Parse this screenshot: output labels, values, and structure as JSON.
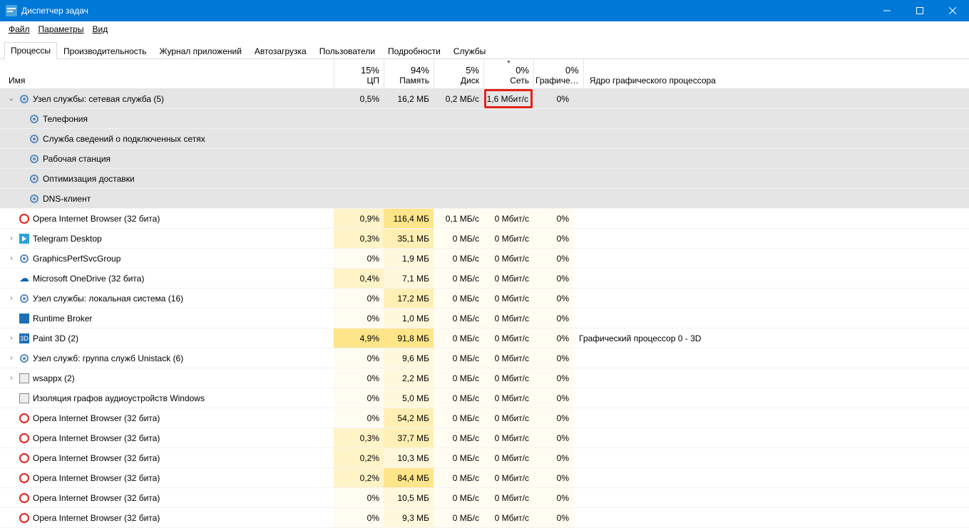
{
  "window": {
    "title": "Диспетчер задач"
  },
  "menu": {
    "file": "Файл",
    "options": "Параметры",
    "view": "Вид"
  },
  "tabs": {
    "processes": "Процессы",
    "performance": "Производительность",
    "apphistory": "Журнал приложений",
    "startup": "Автозагрузка",
    "users": "Пользователи",
    "details": "Подробности",
    "services": "Службы"
  },
  "columns": {
    "name": "Имя",
    "cpu_pct": "15%",
    "cpu_label": "ЦП",
    "mem_pct": "94%",
    "mem_label": "Память",
    "disk_pct": "5%",
    "disk_label": "Диск",
    "net_pct": "0%",
    "net_label": "Сеть",
    "gpu_pct": "0%",
    "gpu_label": "Графиче…",
    "gpue_label": "Ядро графического процессора"
  },
  "selected": {
    "name": "Узел службы: сетевая служба (5)",
    "cpu": "0,5%",
    "mem": "16,2 МБ",
    "disk": "0,2 МБ/с",
    "net": "1,6 Мбит/с",
    "gpu": "0%",
    "children": [
      "Телефония",
      "Служба сведений о подключенных сетях",
      "Рабочая станция",
      "Оптимизация доставки",
      "DNS-клиент"
    ]
  },
  "rows": [
    {
      "icon": "opera",
      "name": "Opera Internet Browser (32 бита)",
      "cpu": "0,9%",
      "mem": "116,4 МБ",
      "mem_h": 3,
      "cpu_h": 1,
      "disk": "0,1 МБ/с",
      "net": "0 Мбит/с",
      "gpu": "0%",
      "gpue": ""
    },
    {
      "icon": "telegram",
      "exp": true,
      "name": "Telegram Desktop",
      "cpu": "0,3%",
      "mem": "35,1 МБ",
      "mem_h": 2,
      "cpu_h": 1,
      "disk": "0 МБ/с",
      "net": "0 Мбит/с",
      "gpu": "0%",
      "gpue": ""
    },
    {
      "icon": "gear",
      "exp": true,
      "name": "GraphicsPerfSvcGroup",
      "cpu": "0%",
      "mem": "1,9 МБ",
      "mem_h": 1,
      "cpu_h": 0,
      "disk": "0 МБ/с",
      "net": "0 Мбит/с",
      "gpu": "0%",
      "gpue": ""
    },
    {
      "icon": "onedrive",
      "name": "Microsoft OneDrive (32 бита)",
      "cpu": "0,4%",
      "mem": "7,1 МБ",
      "mem_h": 1,
      "cpu_h": 1,
      "disk": "0 МБ/с",
      "net": "0 Мбит/с",
      "gpu": "0%",
      "gpue": ""
    },
    {
      "icon": "gear",
      "exp": true,
      "name": "Узел службы: локальная система (16)",
      "cpu": "0%",
      "mem": "17,2 МБ",
      "mem_h": 2,
      "cpu_h": 0,
      "disk": "0 МБ/с",
      "net": "0 Мбит/с",
      "gpu": "0%",
      "gpue": ""
    },
    {
      "icon": "runtime",
      "name": "Runtime Broker",
      "cpu": "0%",
      "mem": "1,0 МБ",
      "mem_h": 1,
      "cpu_h": 0,
      "disk": "0 МБ/с",
      "net": "0 Мбит/с",
      "gpu": "0%",
      "gpue": ""
    },
    {
      "icon": "paint3d",
      "exp": true,
      "name": "Paint 3D (2)",
      "cpu": "4,9%",
      "mem": "91,8 МБ",
      "mem_h": 3,
      "cpu_h": 2,
      "disk": "0 МБ/с",
      "net": "0 Мбит/с",
      "gpu": "0%",
      "gpue": "Графический процессор 0 - 3D"
    },
    {
      "icon": "gear",
      "exp": true,
      "name": "Узел служб: группа служб Unistack (6)",
      "cpu": "0%",
      "mem": "9,6 МБ",
      "mem_h": 1,
      "cpu_h": 0,
      "disk": "0 МБ/с",
      "net": "0 Мбит/с",
      "gpu": "0%",
      "gpue": ""
    },
    {
      "icon": "generic",
      "exp": true,
      "name": "wsappx (2)",
      "cpu": "0%",
      "mem": "2,2 МБ",
      "mem_h": 1,
      "cpu_h": 0,
      "disk": "0 МБ/с",
      "net": "0 Мбит/с",
      "gpu": "0%",
      "gpue": ""
    },
    {
      "icon": "generic",
      "name": "Изоляция графов аудиоустройств Windows",
      "cpu": "0%",
      "mem": "5,0 МБ",
      "mem_h": 1,
      "cpu_h": 0,
      "disk": "0 МБ/с",
      "net": "0 Мбит/с",
      "gpu": "0%",
      "gpue": ""
    },
    {
      "icon": "opera",
      "name": "Opera Internet Browser (32 бита)",
      "cpu": "0%",
      "mem": "54,2 МБ",
      "mem_h": 2,
      "cpu_h": 0,
      "disk": "0 МБ/с",
      "net": "0 Мбит/с",
      "gpu": "0%",
      "gpue": ""
    },
    {
      "icon": "opera",
      "name": "Opera Internet Browser (32 бита)",
      "cpu": "0,3%",
      "mem": "37,7 МБ",
      "mem_h": 2,
      "cpu_h": 1,
      "disk": "0 МБ/с",
      "net": "0 Мбит/с",
      "gpu": "0%",
      "gpue": ""
    },
    {
      "icon": "opera",
      "name": "Opera Internet Browser (32 бита)",
      "cpu": "0,2%",
      "mem": "10,3 МБ",
      "mem_h": 1,
      "cpu_h": 1,
      "disk": "0 МБ/с",
      "net": "0 Мбит/с",
      "gpu": "0%",
      "gpue": ""
    },
    {
      "icon": "opera",
      "name": "Opera Internet Browser (32 бита)",
      "cpu": "0,2%",
      "mem": "84,4 МБ",
      "mem_h": 3,
      "cpu_h": 1,
      "disk": "0 МБ/с",
      "net": "0 Мбит/с",
      "gpu": "0%",
      "gpue": ""
    },
    {
      "icon": "opera",
      "name": "Opera Internet Browser (32 бита)",
      "cpu": "0%",
      "mem": "10,5 МБ",
      "mem_h": 1,
      "cpu_h": 0,
      "disk": "0 МБ/с",
      "net": "0 Мбит/с",
      "gpu": "0%",
      "gpue": ""
    },
    {
      "icon": "opera",
      "name": "Opera Internet Browser (32 бита)",
      "cpu": "0%",
      "mem": "9,3 МБ",
      "mem_h": 1,
      "cpu_h": 0,
      "disk": "0 МБ/с",
      "net": "0 Мбит/с",
      "gpu": "0%",
      "gpue": ""
    }
  ]
}
